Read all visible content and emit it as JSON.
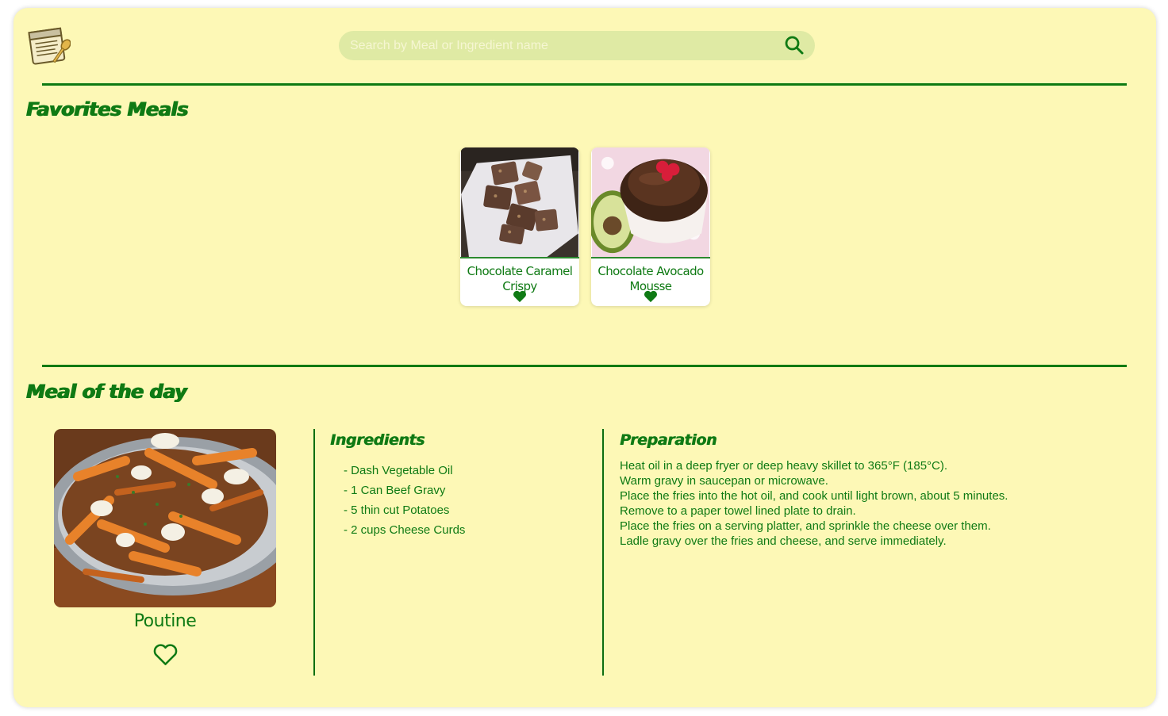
{
  "colors": {
    "background": "#fdf8b6",
    "accent": "#0f7a14",
    "search_bg": "#dfeaa4"
  },
  "header": {
    "logo_icon": "recipe-book-icon",
    "search": {
      "placeholder": "Search by Meal or Ingredient name",
      "value": "",
      "icon": "search-icon"
    }
  },
  "favorites": {
    "title": "Favorites Meals",
    "items": [
      {
        "name": "Chocolate Caramel Crispy",
        "favorited": true
      },
      {
        "name": "Chocolate Avocado Mousse",
        "favorited": true
      }
    ]
  },
  "meal_of_day": {
    "title": "Meal of the day",
    "meal_name": "Poutine",
    "favorited": false,
    "ingredients_title": "Ingredients",
    "ingredients": [
      "- Dash Vegetable Oil",
      "- 1 Can Beef Gravy",
      "- 5 thin cut Potatoes",
      "- 2 cups Cheese Curds"
    ],
    "preparation_title": "Preparation",
    "preparation": [
      "Heat oil in a deep fryer or deep heavy skillet to 365°F (185°C).",
      "Warm gravy in saucepan or microwave.",
      "Place the fries into the hot oil, and cook until light brown, about 5 minutes.",
      "Remove to a paper towel lined plate to drain.",
      "Place the fries on a serving platter, and sprinkle the cheese over them.",
      "Ladle gravy over the fries and cheese, and serve immediately."
    ]
  }
}
